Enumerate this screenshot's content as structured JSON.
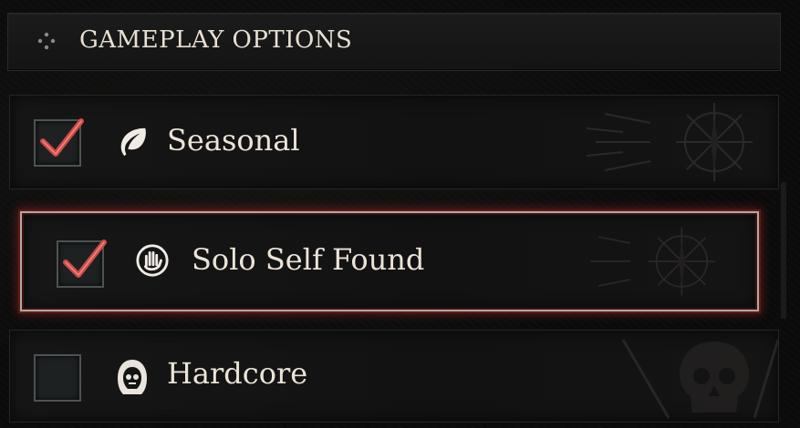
{
  "header": {
    "title": "GAMEPLAY OPTIONS",
    "icon": "diamond-dots-icon"
  },
  "options": [
    {
      "label": "Seasonal",
      "checked": true,
      "icon": "leaf-icon"
    },
    {
      "label": "Solo Self Found",
      "checked": true,
      "icon": "hand-icon",
      "selected": true
    },
    {
      "label": "Hardcore",
      "checked": false,
      "icon": "reaper-icon"
    }
  ],
  "colors": {
    "check": "#d14a44",
    "selected_border": "#b9a7a0",
    "glow": "#8e2a20"
  }
}
